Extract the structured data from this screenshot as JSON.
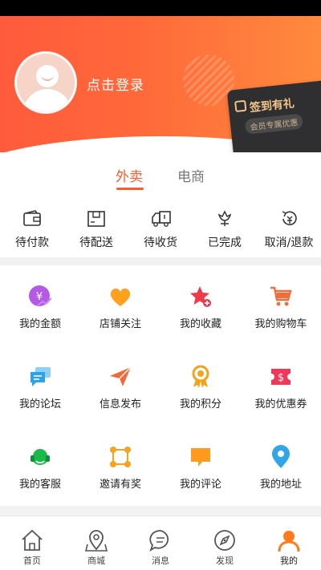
{
  "header": {
    "login_text": "点击登录",
    "signin_title": "签到有礼",
    "signin_sub": "会员专属优惠"
  },
  "tabs": [
    {
      "label": "外卖",
      "active": true
    },
    {
      "label": "电商",
      "active": false
    }
  ],
  "orders": [
    {
      "label": "待付款",
      "icon": "wallet-icon"
    },
    {
      "label": "待配送",
      "icon": "package-icon"
    },
    {
      "label": "待收货",
      "icon": "truck-icon"
    },
    {
      "label": "已完成",
      "icon": "flower-icon"
    },
    {
      "label": "取消/退款",
      "icon": "refund-icon"
    }
  ],
  "services": [
    {
      "label": "我的金额",
      "icon": "money-icon",
      "color": "#b65ae6"
    },
    {
      "label": "店铺关注",
      "icon": "heart-icon",
      "color": "#ffa11f"
    },
    {
      "label": "我的收藏",
      "icon": "star-icon",
      "color": "#f0384b"
    },
    {
      "label": "我的购物车",
      "icon": "cart-icon",
      "color": "#f56a3b"
    },
    {
      "label": "我的论坛",
      "icon": "chat-icon",
      "color": "#2fa2e6"
    },
    {
      "label": "信息发布",
      "icon": "send-icon",
      "color": "#f06a3d"
    },
    {
      "label": "我的积分",
      "icon": "medal-icon",
      "color": "#f3a21a"
    },
    {
      "label": "我的优惠券",
      "icon": "coupon-icon",
      "color": "#f0385a"
    },
    {
      "label": "我的客服",
      "icon": "headset-icon",
      "color": "#19b94a"
    },
    {
      "label": "邀请有奖",
      "icon": "invite-icon",
      "color": "#f5a41c"
    },
    {
      "label": "我的评论",
      "icon": "comment-icon",
      "color": "#ff9a1a"
    },
    {
      "label": "我的地址",
      "icon": "location-icon",
      "color": "#30a6e8"
    }
  ],
  "nav": [
    {
      "label": "首页",
      "icon": "home-icon",
      "active": false
    },
    {
      "label": "商城",
      "icon": "store-location-icon",
      "active": false
    },
    {
      "label": "消息",
      "icon": "message-icon",
      "active": false
    },
    {
      "label": "发现",
      "icon": "compass-icon",
      "active": false
    },
    {
      "label": "我的",
      "icon": "user-icon",
      "active": true
    }
  ],
  "colors": {
    "accent": "#ff5a2c",
    "header_start": "#ff5a3c",
    "header_end": "#ff8a3d",
    "nav_active": "#ff7a1a"
  }
}
